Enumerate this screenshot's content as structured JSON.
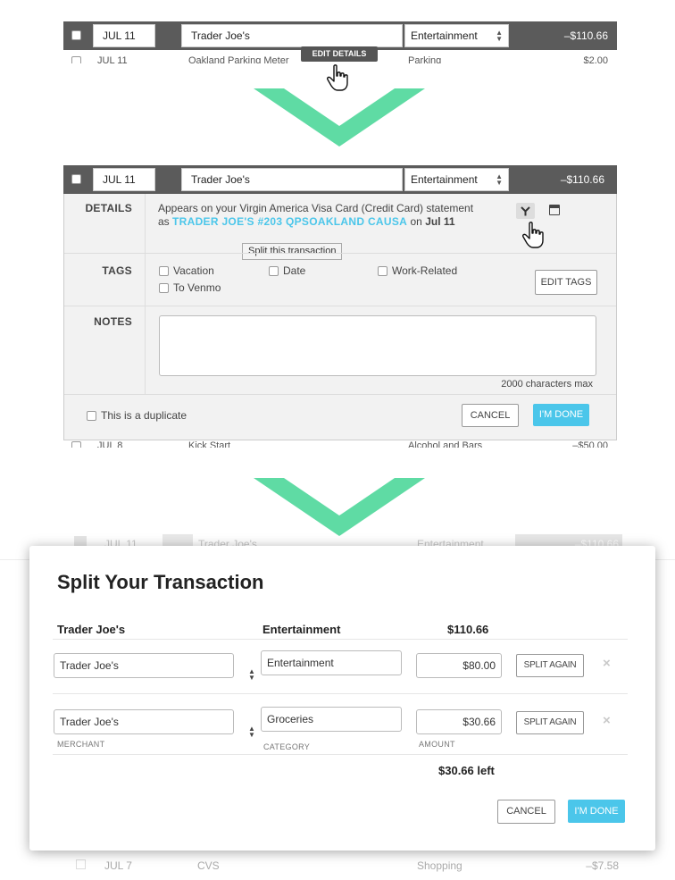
{
  "top_row": {
    "date": "JUL 11",
    "merchant": "Trader Joe's",
    "category": "Entertainment",
    "amount": "–$110.66",
    "tooltip": "EDIT DETAILS",
    "peek_date": "JUL 11",
    "peek_merchant": "Oakland Parking Meter",
    "peek_category": "Parking",
    "peek_amount": "$2.00"
  },
  "expanded": {
    "date": "JUL 11",
    "merchant": "Trader Joe's",
    "category": "Entertainment",
    "amount": "–$110.66",
    "details_label": "DETAILS",
    "details_line1": "Appears on your Virgin America Visa Card (Credit Card) statement",
    "details_as": "as",
    "details_statement": "TRADER JOE'S #203 QPSOAKLAND CAUSA",
    "details_on": "on",
    "details_date": "Jul 11",
    "split_tooltip": "Split this transaction",
    "tags_label": "TAGS",
    "tags": [
      "Vacation",
      "Date",
      "Work-Related",
      "To Venmo"
    ],
    "edit_tags": "EDIT TAGS",
    "notes_label": "NOTES",
    "notes_hint": "2000 characters max",
    "duplicate": "This is a duplicate",
    "cancel": "CANCEL",
    "done": "I'M DONE",
    "peek_date": "JUL 8",
    "peek_merchant": "Kick Start",
    "peek_category": "Alcohol and Bars",
    "peek_amount": "–$50.00"
  },
  "background": {
    "date": "JUL 11",
    "merchant": "Trader Joe's",
    "category": "Entertainment",
    "amount": "–$110.66",
    "bottom_date": "JUL 7",
    "bottom_merchant": "CVS",
    "bottom_category": "Shopping",
    "bottom_amount": "–$7.58"
  },
  "modal": {
    "title": "Split Your Transaction",
    "header_merchant": "Trader Joe's",
    "header_category": "Entertainment",
    "header_amount": "$110.66",
    "rows": [
      {
        "merchant": "Trader Joe's",
        "category": "Entertainment",
        "amount": "$80.00",
        "split": "SPLIT AGAIN"
      },
      {
        "merchant": "Trader Joe's",
        "category": "Groceries",
        "amount": "$30.66",
        "split": "SPLIT AGAIN"
      }
    ],
    "cap_merchant": "MERCHANT",
    "cap_category": "CATEGORY",
    "cap_amount": "AMOUNT",
    "left": "$30.66 left",
    "cancel": "CANCEL",
    "done": "I'M DONE"
  },
  "colors": {
    "row_dark": "#5b5b5b",
    "accent_blue": "#4bc6ea",
    "arrow_green": "#5fdba4"
  }
}
